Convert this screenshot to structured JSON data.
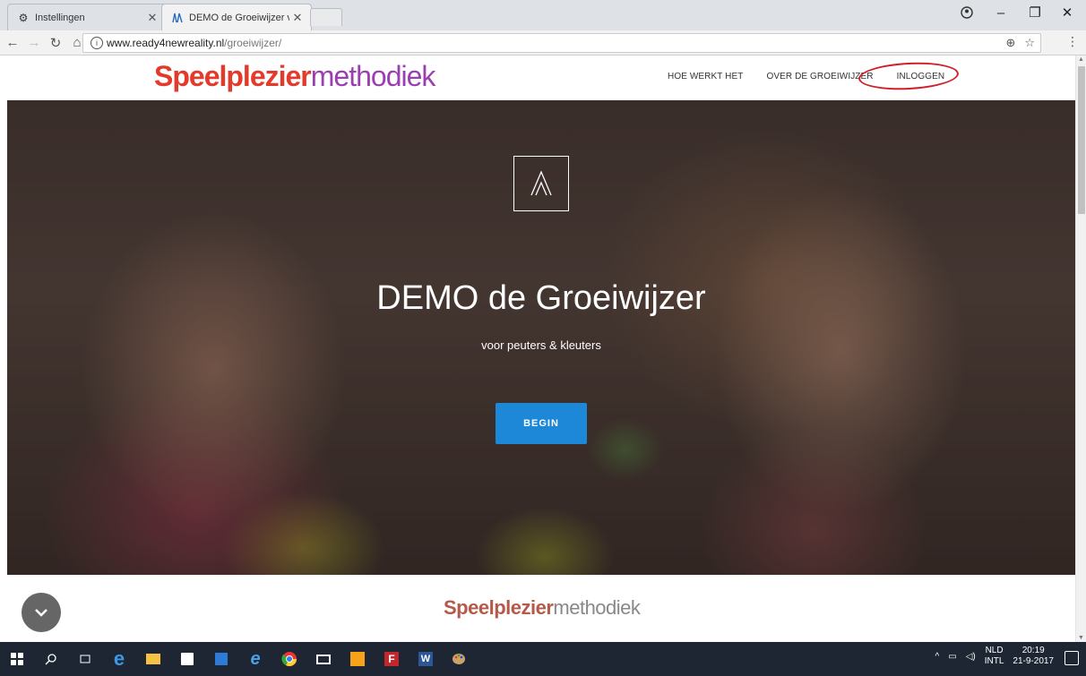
{
  "browser": {
    "tabs": [
      {
        "title": "Instellingen",
        "icon": "gear-icon"
      },
      {
        "title": "DEMO de Groeiwijzer vo",
        "icon": "site-favicon"
      }
    ],
    "address": {
      "host": "www.ready4newreality.nl",
      "path": "/groeiwijzer/"
    }
  },
  "site": {
    "logo": {
      "p1": "Speelplezier",
      "p2": "methodiek"
    },
    "nav": [
      "HOE WERKT HET",
      "OVER DE GROEIWIJZER",
      "INLOGGEN"
    ],
    "hero": {
      "title": "DEMO de Groeiwijzer",
      "subtitle": "voor peuters & kleuters",
      "cta": "BEGIN"
    }
  },
  "taskbar": {
    "lang_top": "NLD",
    "lang_bottom": "INTL",
    "time": "20:19",
    "date": "21-9-2017"
  },
  "colors": {
    "accent_button": "#1e88d8",
    "annotation_circle": "#d21f2a"
  }
}
